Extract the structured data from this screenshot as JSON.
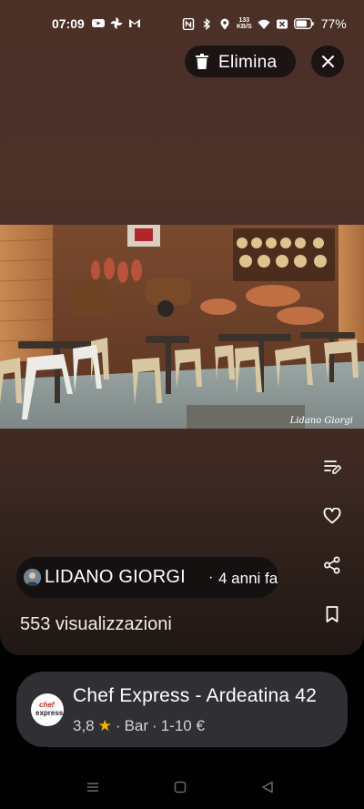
{
  "status_bar": {
    "time": "07:09",
    "net_speed_value": "133",
    "net_speed_unit": "KB/S",
    "battery_pct": "77%"
  },
  "toolbar": {
    "delete_label": "Elimina",
    "close_icon": "close-icon",
    "delete_icon": "trash-icon"
  },
  "photo": {
    "watermark": "Lidano Giorgi"
  },
  "side_actions": [
    {
      "icon": "edit-note-icon"
    },
    {
      "icon": "heart-icon"
    },
    {
      "icon": "share-icon"
    },
    {
      "icon": "bookmark-icon"
    }
  ],
  "author": {
    "name": "LIDANO GIORGI",
    "separator": "·",
    "when": "4 anni fa"
  },
  "views_text": "553 visualizzazioni",
  "place": {
    "name": "Chef Express - Ardeatina 42",
    "rating": "3,8",
    "category": "Bar",
    "price": "1-10 €",
    "separator": "·",
    "logo_line1": "chef",
    "logo_line2": "express"
  },
  "colors": {
    "accent_star": "#f4b400",
    "card_bg": "#303034",
    "viewer_bg": "#4a3027"
  }
}
